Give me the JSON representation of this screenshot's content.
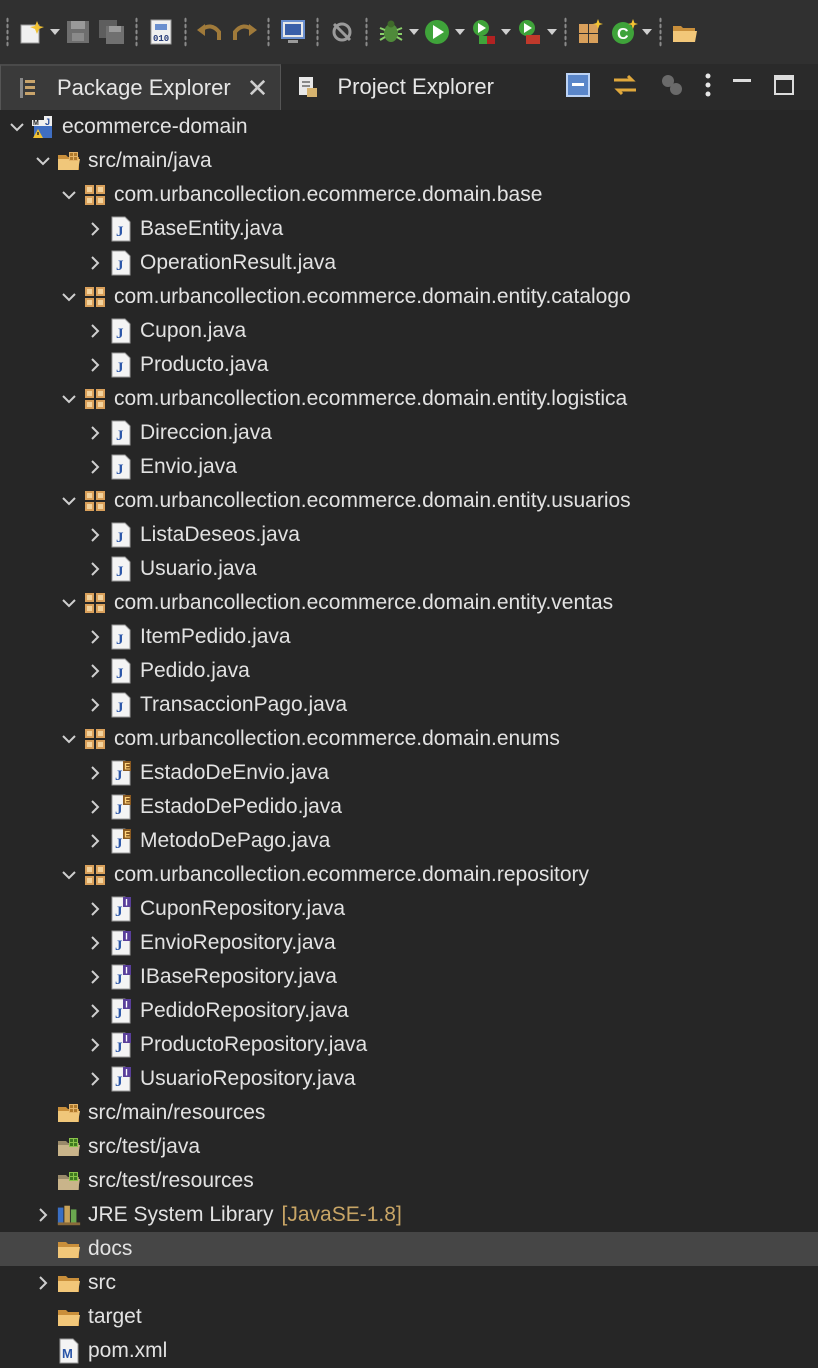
{
  "tabs": {
    "package_explorer": "Package Explorer",
    "project_explorer": "Project Explorer",
    "close_glyph": "✕"
  },
  "toolbar": {
    "icons": [
      "new-icon",
      "save-icon",
      "save-all-icon",
      "binary-icon",
      "undo-icon",
      "redo-icon",
      "console-icon",
      "skip-breakpoints-icon",
      "debug-icon",
      "run-icon",
      "coverage-icon",
      "external-tools-icon",
      "new-package-icon",
      "new-class-icon",
      "open-type-icon"
    ]
  },
  "tree": [
    {
      "label": "ecommerce-domain",
      "depth": 0,
      "expander": "open",
      "icon": "maven-project-icon"
    },
    {
      "label": "src/main/java",
      "depth": 1,
      "expander": "open",
      "icon": "source-folder-icon"
    },
    {
      "label": "com.urbancollection.ecommerce.domain.base",
      "depth": 2,
      "expander": "open",
      "icon": "package-icon"
    },
    {
      "label": "BaseEntity.java",
      "depth": 3,
      "expander": "closed",
      "icon": "java-file-icon"
    },
    {
      "label": "OperationResult.java",
      "depth": 3,
      "expander": "closed",
      "icon": "java-file-icon"
    },
    {
      "label": "com.urbancollection.ecommerce.domain.entity.catalogo",
      "depth": 2,
      "expander": "open",
      "icon": "package-icon"
    },
    {
      "label": "Cupon.java",
      "depth": 3,
      "expander": "closed",
      "icon": "java-file-icon"
    },
    {
      "label": "Producto.java",
      "depth": 3,
      "expander": "closed",
      "icon": "java-file-icon"
    },
    {
      "label": "com.urbancollection.ecommerce.domain.entity.logistica",
      "depth": 2,
      "expander": "open",
      "icon": "package-icon"
    },
    {
      "label": "Direccion.java",
      "depth": 3,
      "expander": "closed",
      "icon": "java-file-icon"
    },
    {
      "label": "Envio.java",
      "depth": 3,
      "expander": "closed",
      "icon": "java-file-icon"
    },
    {
      "label": "com.urbancollection.ecommerce.domain.entity.usuarios",
      "depth": 2,
      "expander": "open",
      "icon": "package-icon"
    },
    {
      "label": "ListaDeseos.java",
      "depth": 3,
      "expander": "closed",
      "icon": "java-file-icon"
    },
    {
      "label": "Usuario.java",
      "depth": 3,
      "expander": "closed",
      "icon": "java-file-icon"
    },
    {
      "label": "com.urbancollection.ecommerce.domain.entity.ventas",
      "depth": 2,
      "expander": "open",
      "icon": "package-icon"
    },
    {
      "label": "ItemPedido.java",
      "depth": 3,
      "expander": "closed",
      "icon": "java-file-icon"
    },
    {
      "label": "Pedido.java",
      "depth": 3,
      "expander": "closed",
      "icon": "java-file-icon"
    },
    {
      "label": "TransaccionPago.java",
      "depth": 3,
      "expander": "closed",
      "icon": "java-file-icon"
    },
    {
      "label": "com.urbancollection.ecommerce.domain.enums",
      "depth": 2,
      "expander": "open",
      "icon": "package-icon"
    },
    {
      "label": "EstadoDeEnvio.java",
      "depth": 3,
      "expander": "closed",
      "icon": "java-enum-icon"
    },
    {
      "label": "EstadoDePedido.java",
      "depth": 3,
      "expander": "closed",
      "icon": "java-enum-icon"
    },
    {
      "label": "MetodoDePago.java",
      "depth": 3,
      "expander": "closed",
      "icon": "java-enum-icon"
    },
    {
      "label": "com.urbancollection.ecommerce.domain.repository",
      "depth": 2,
      "expander": "open",
      "icon": "package-icon"
    },
    {
      "label": "CuponRepository.java",
      "depth": 3,
      "expander": "closed",
      "icon": "java-interface-icon"
    },
    {
      "label": "EnvioRepository.java",
      "depth": 3,
      "expander": "closed",
      "icon": "java-interface-icon"
    },
    {
      "label": "IBaseRepository.java",
      "depth": 3,
      "expander": "closed",
      "icon": "java-interface-icon"
    },
    {
      "label": "PedidoRepository.java",
      "depth": 3,
      "expander": "closed",
      "icon": "java-interface-icon"
    },
    {
      "label": "ProductoRepository.java",
      "depth": 3,
      "expander": "closed",
      "icon": "java-interface-icon"
    },
    {
      "label": "UsuarioRepository.java",
      "depth": 3,
      "expander": "closed",
      "icon": "java-interface-icon"
    },
    {
      "label": "src/main/resources",
      "depth": 1,
      "expander": "none",
      "icon": "source-folder-icon"
    },
    {
      "label": "src/test/java",
      "depth": 1,
      "expander": "none",
      "icon": "test-folder-icon"
    },
    {
      "label": "src/test/resources",
      "depth": 1,
      "expander": "none",
      "icon": "test-folder-icon"
    },
    {
      "label": "JRE System Library",
      "decor": "[JavaSE-1.8]",
      "depth": 1,
      "expander": "closed",
      "icon": "library-icon"
    },
    {
      "label": "docs",
      "depth": 1,
      "expander": "none",
      "icon": "folder-icon",
      "selected": true
    },
    {
      "label": "src",
      "depth": 1,
      "expander": "closed",
      "icon": "folder-icon"
    },
    {
      "label": "target",
      "depth": 1,
      "expander": "none",
      "icon": "folder-icon"
    },
    {
      "label": "pom.xml",
      "depth": 1,
      "expander": "none",
      "icon": "maven-pom-icon"
    }
  ],
  "colors": {
    "background": "#262626",
    "selection": "#464646",
    "text": "#e2e2e2",
    "decoration": "#c8a566"
  }
}
